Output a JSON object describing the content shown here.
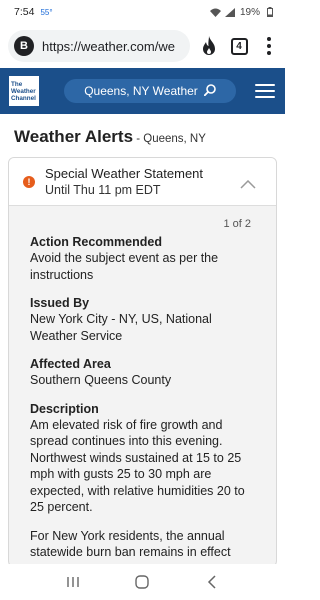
{
  "status_bar": {
    "time": "7:54",
    "temperature": "55°",
    "battery": "19%"
  },
  "browser": {
    "site_badge": "B",
    "url": "https://weather.com/we",
    "tab_count": "4"
  },
  "header": {
    "logo_lines": [
      "The",
      "Weather",
      "Channel"
    ],
    "search_label": "Queens, NY Weather"
  },
  "page": {
    "title": "Weather Alerts",
    "location_suffix": " - Queens, NY"
  },
  "alert": {
    "title": "Special Weather Statement",
    "until": "Until Thu 11 pm EDT",
    "pager": "1 of 2",
    "sections": [
      {
        "title": "Action Recommended",
        "text": "Avoid the subject event as per the instructions"
      },
      {
        "title": "Issued By",
        "text": "New York City - NY, US, National Weather Service"
      },
      {
        "title": "Affected Area",
        "text": "Southern Queens County"
      },
      {
        "title": "Description",
        "text": "Am elevated risk of fire growth and spread continues into this evening. Northwest winds sustained at 15 to 25 mph with gusts 25 to 30 mph are expected, with relative humidities 20 to 25 percent."
      }
    ],
    "extra_paragraph": "For New York residents, the annual statewide burn ban remains in effect"
  },
  "colors": {
    "header_blue": "#1b4f8a",
    "search_pill": "#2d67a6",
    "warning_orange": "#e65d1c",
    "card_background": "#f3f3f3"
  },
  "icons": {
    "status": [
      "wifi-icon",
      "signal-icon",
      "battery-icon"
    ],
    "browser": [
      "flame-icon",
      "tabs-icon",
      "more-options-icon"
    ],
    "header": [
      "search-icon",
      "hamburger-menu-icon"
    ],
    "card": [
      "warning-icon",
      "chevron-up-icon"
    ],
    "nav": [
      "recent-apps-icon",
      "home-icon",
      "back-icon"
    ]
  }
}
